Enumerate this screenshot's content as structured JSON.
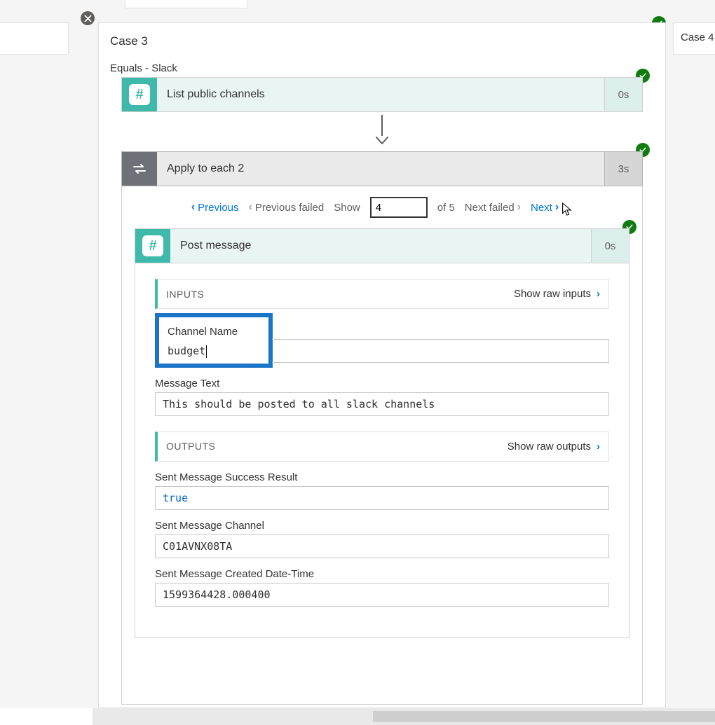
{
  "case3": {
    "title": "Case 3",
    "equals": "Equals - Slack"
  },
  "case4": {
    "title": "Case 4"
  },
  "list_channels": {
    "title": "List public channels",
    "duration": "0s"
  },
  "apply_each": {
    "title": "Apply to each 2",
    "duration": "3s"
  },
  "pager": {
    "previous": "Previous",
    "previous_failed": "Previous failed",
    "show_label": "Show",
    "index": "4",
    "of_label": "of 5",
    "next_failed": "Next failed",
    "next": "Next"
  },
  "post_message": {
    "title": "Post message",
    "duration": "0s"
  },
  "inputs": {
    "section_label": "INPUTS",
    "raw_link": "Show raw inputs",
    "channel_name_label": "Channel Name",
    "channel_name_value": "budget",
    "message_text_label": "Message Text",
    "message_text_value": "This should be posted to all slack channels"
  },
  "outputs": {
    "section_label": "OUTPUTS",
    "raw_link": "Show raw outputs",
    "success_label": "Sent Message Success Result",
    "success_value": "true",
    "channel_label": "Sent Message Channel",
    "channel_value": "C01AVNX08TA",
    "datetime_label": "Sent Message Created Date-Time",
    "datetime_value": "1599364428.000400"
  }
}
